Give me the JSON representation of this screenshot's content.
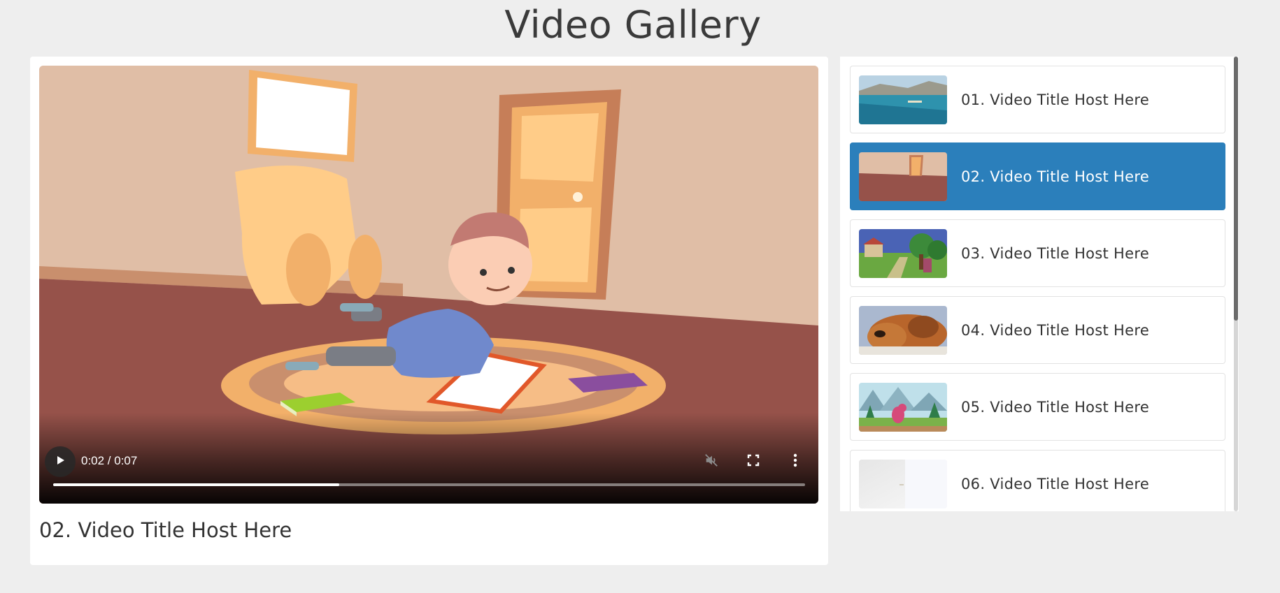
{
  "page": {
    "title": "Video Gallery"
  },
  "player": {
    "time": "0:02 / 0:07",
    "progress": 0.38,
    "muted": true,
    "icons": {
      "play": "play-icon",
      "mute": "mute-icon",
      "fullscreen": "fullscreen-icon",
      "more": "more-vert-icon"
    }
  },
  "current": {
    "title": "02. Video Title Host Here"
  },
  "playlist": {
    "active_index": 1,
    "items": [
      {
        "label": "01. Video Title Host Here",
        "thumb": "beach-coast-thumbnail"
      },
      {
        "label": "02. Video Title Host Here",
        "thumb": "cartoon-room-thumbnail"
      },
      {
        "label": "03. Video Title Host Here",
        "thumb": "cartoon-village-thumbnail"
      },
      {
        "label": "04. Video Title Host Here",
        "thumb": "dog-thumbnail"
      },
      {
        "label": "05. Video Title Host Here",
        "thumb": "cartoon-dinosaur-thumbnail"
      },
      {
        "label": "06. Video Title Host Here",
        "thumb": "blank-thumbnail"
      }
    ]
  },
  "colors": {
    "accent": "#2b7fbb",
    "background": "#eeeeee"
  }
}
